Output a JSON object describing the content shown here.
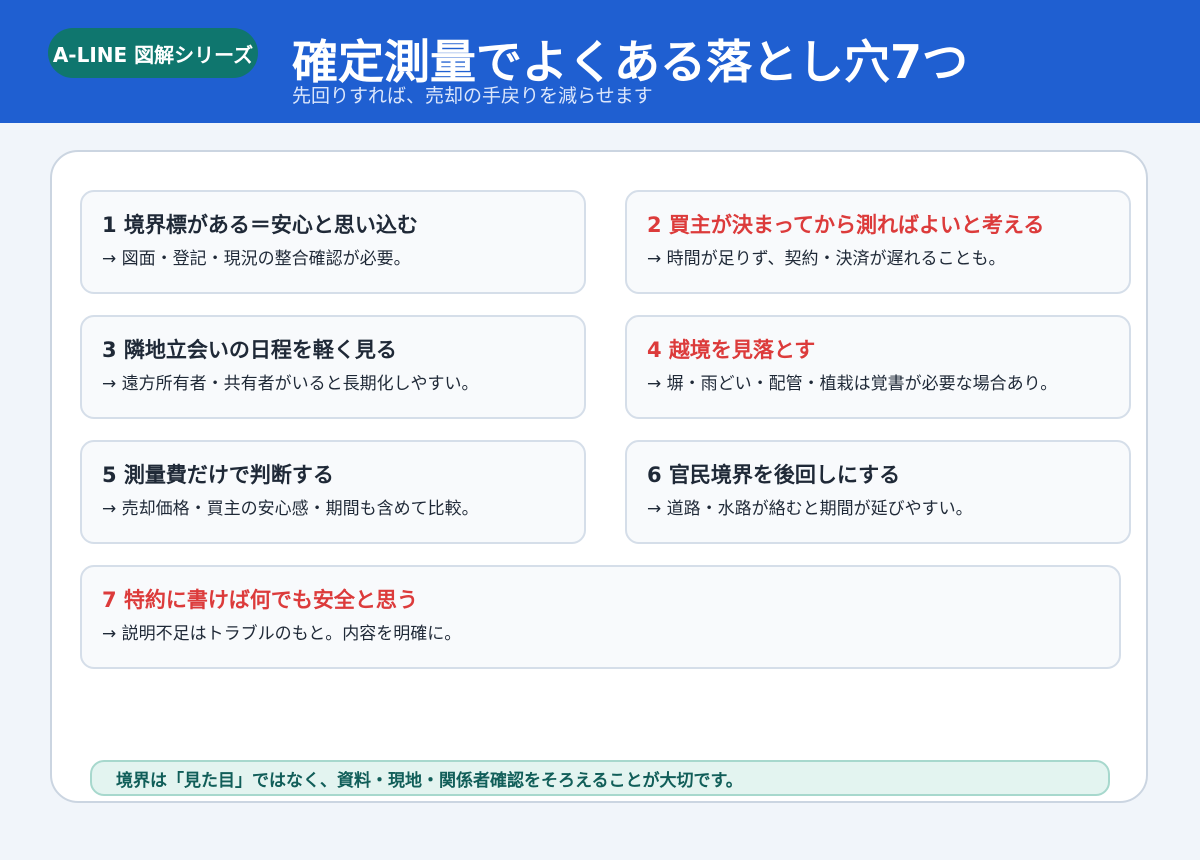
{
  "header": {
    "badge": "A-LINE 図解シリーズ",
    "title": "確定測量でよくある落とし穴7つ",
    "subtitle": "先回りすれば、売却の手戻りを減らせます"
  },
  "colors": {
    "header_bg": "#1f5fd1",
    "badge_bg": "#0f766e",
    "warning_title": "#dc3b3b",
    "normal_title": "#1f2937"
  },
  "cards": [
    {
      "title": "1 境界標がある＝安心と思い込む",
      "desc": "→ 図面・登記・現況の整合確認が必要。",
      "highlight": false
    },
    {
      "title": "2 買主が決まってから測ればよいと考える",
      "desc": "→ 時間が足りず、契約・決済が遅れることも。",
      "highlight": true
    },
    {
      "title": "3 隣地立会いの日程を軽く見る",
      "desc": "→ 遠方所有者・共有者がいると長期化しやすい。",
      "highlight": false
    },
    {
      "title": "4 越境を見落とす",
      "desc": "→ 塀・雨どい・配管・植栽は覚書が必要な場合あり。",
      "highlight": true
    },
    {
      "title": "5 測量費だけで判断する",
      "desc": "→ 売却価格・買主の安心感・期間も含めて比較。",
      "highlight": false
    },
    {
      "title": "6 官民境界を後回しにする",
      "desc": "→ 道路・水路が絡むと期間が延びやすい。",
      "highlight": false
    },
    {
      "title": "7 特約に書けば何でも安全と思う",
      "desc": "→ 説明不足はトラブルのもと。内容を明確に。",
      "highlight": true
    }
  ],
  "footer": {
    "note": "境界は「見た目」ではなく、資料・現地・関係者確認をそろえることが大切です。"
  }
}
